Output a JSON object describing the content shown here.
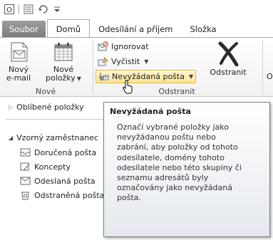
{
  "quick_access": {
    "icons": [
      "outlook-logo-icon",
      "send-receive-icon",
      "undo-icon",
      "customize-icon"
    ]
  },
  "tabs": [
    {
      "label": "Soubor"
    },
    {
      "label": "Domů"
    },
    {
      "label": "Odesílání a příjem"
    },
    {
      "label": "Složka"
    }
  ],
  "ribbon": {
    "new_group": {
      "new_email_line1": "Nový",
      "new_email_line2": "e-mail",
      "new_items_line1": "Nové",
      "new_items_line2": "položky",
      "label": "Nové"
    },
    "delete_group": {
      "ignore": "Ignorovat",
      "clean": "Vyčistit",
      "junk": "Nevyžádaná pošta",
      "delete": "Odstranit",
      "label": "Odstranit",
      "next_partial": "O"
    }
  },
  "nav": {
    "favorites": "Oblíbené položky",
    "account": "Vzorný zaměstnanec",
    "folders": [
      "Doručená pošta",
      "Koncepty",
      "Odeslaná pošta",
      "Odstraněná pošta"
    ]
  },
  "tooltip": {
    "title": "Nevyžádaná pošta",
    "lines": [
      "Označí vybrané položky jako",
      "nevyžádanou poštu nebo",
      "zabrání, aby položky od tohoto",
      "odesílatele, domény tohoto",
      "odesílatele nebo této skupiny či",
      "seznamu adresátů byly",
      "označovány jako nevyžádaná",
      "pošta."
    ]
  }
}
